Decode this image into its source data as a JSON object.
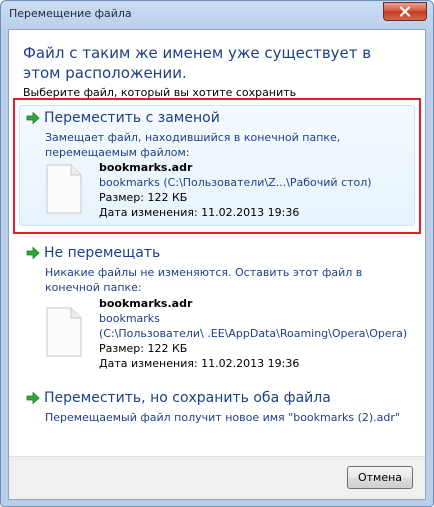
{
  "window": {
    "title": "Перемещение файла",
    "close_icon": "close-icon"
  },
  "main_instruction": "Файл с таким же именем уже существует в этом расположении.",
  "sub_instruction": "Выберите файл, который вы хотите сохранить",
  "options": [
    {
      "title": "Переместить с заменой",
      "description": "Замещает файл, находившийся в конечной папке, перемещаемым файлом:",
      "icon": "green-arrow-icon",
      "file": {
        "name": "bookmarks.adr",
        "path_lines": [
          "bookmarks (C:\\Пользователи\\Z...\\Рабочий стол)"
        ],
        "size": "Размер: 122 КБ",
        "modified": "Дата изменения: 11.02.2013 19:36"
      }
    },
    {
      "title": "Не перемещать",
      "description": "Никакие файлы не изменяются. Оставить этот файл в конечной папке:",
      "icon": "green-arrow-icon",
      "file": {
        "name": "bookmarks.adr",
        "path_lines": [
          "bookmarks",
          "(C:\\Пользователи\\ .EE\\AppData\\Roaming\\Opera\\Opera)"
        ],
        "size": "Размер: 122 КБ",
        "modified": "Дата изменения: 11.02.2013 19:36"
      }
    },
    {
      "title": "Переместить, но сохранить оба файла",
      "description": "Перемещаемый файл получит новое имя \"bookmarks (2).adr\"",
      "icon": "green-arrow-icon"
    }
  ],
  "footer": {
    "cancel_label": "Отмена"
  },
  "colors": {
    "accent_text": "#1e3f88",
    "highlight_border": "#e0202c",
    "arrow_green": "#2ea83a"
  }
}
